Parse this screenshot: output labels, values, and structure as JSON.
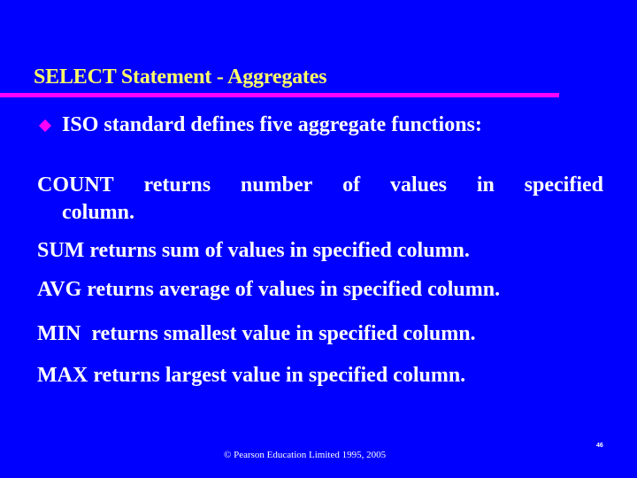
{
  "slide": {
    "title": "SELECT Statement - Aggregates",
    "bullet": "ISO standard defines five aggregate functions:",
    "functions": [
      {
        "name": "COUNT",
        "words": [
          "COUNT",
          "returns",
          "number",
          "of",
          "values",
          "in",
          "specified"
        ],
        "continuation": "column."
      },
      {
        "name": "SUM",
        "text": "SUM returns sum of values in specified column."
      },
      {
        "name": "AVG",
        "text": "AVG returns average of values in specified column."
      },
      {
        "name": "MIN",
        "text": "MIN  returns smallest value in specified column."
      },
      {
        "name": "MAX",
        "text": "MAX returns largest value in specified column."
      }
    ],
    "footer": "© Pearson Education Limited 1995, 2005",
    "page_number": "46",
    "colors": {
      "background": "#0000ff",
      "title": "#ffff66",
      "accent_bar": "#ff00ff",
      "bullet": "#ff00ff",
      "body_text": "#ffffff"
    }
  }
}
